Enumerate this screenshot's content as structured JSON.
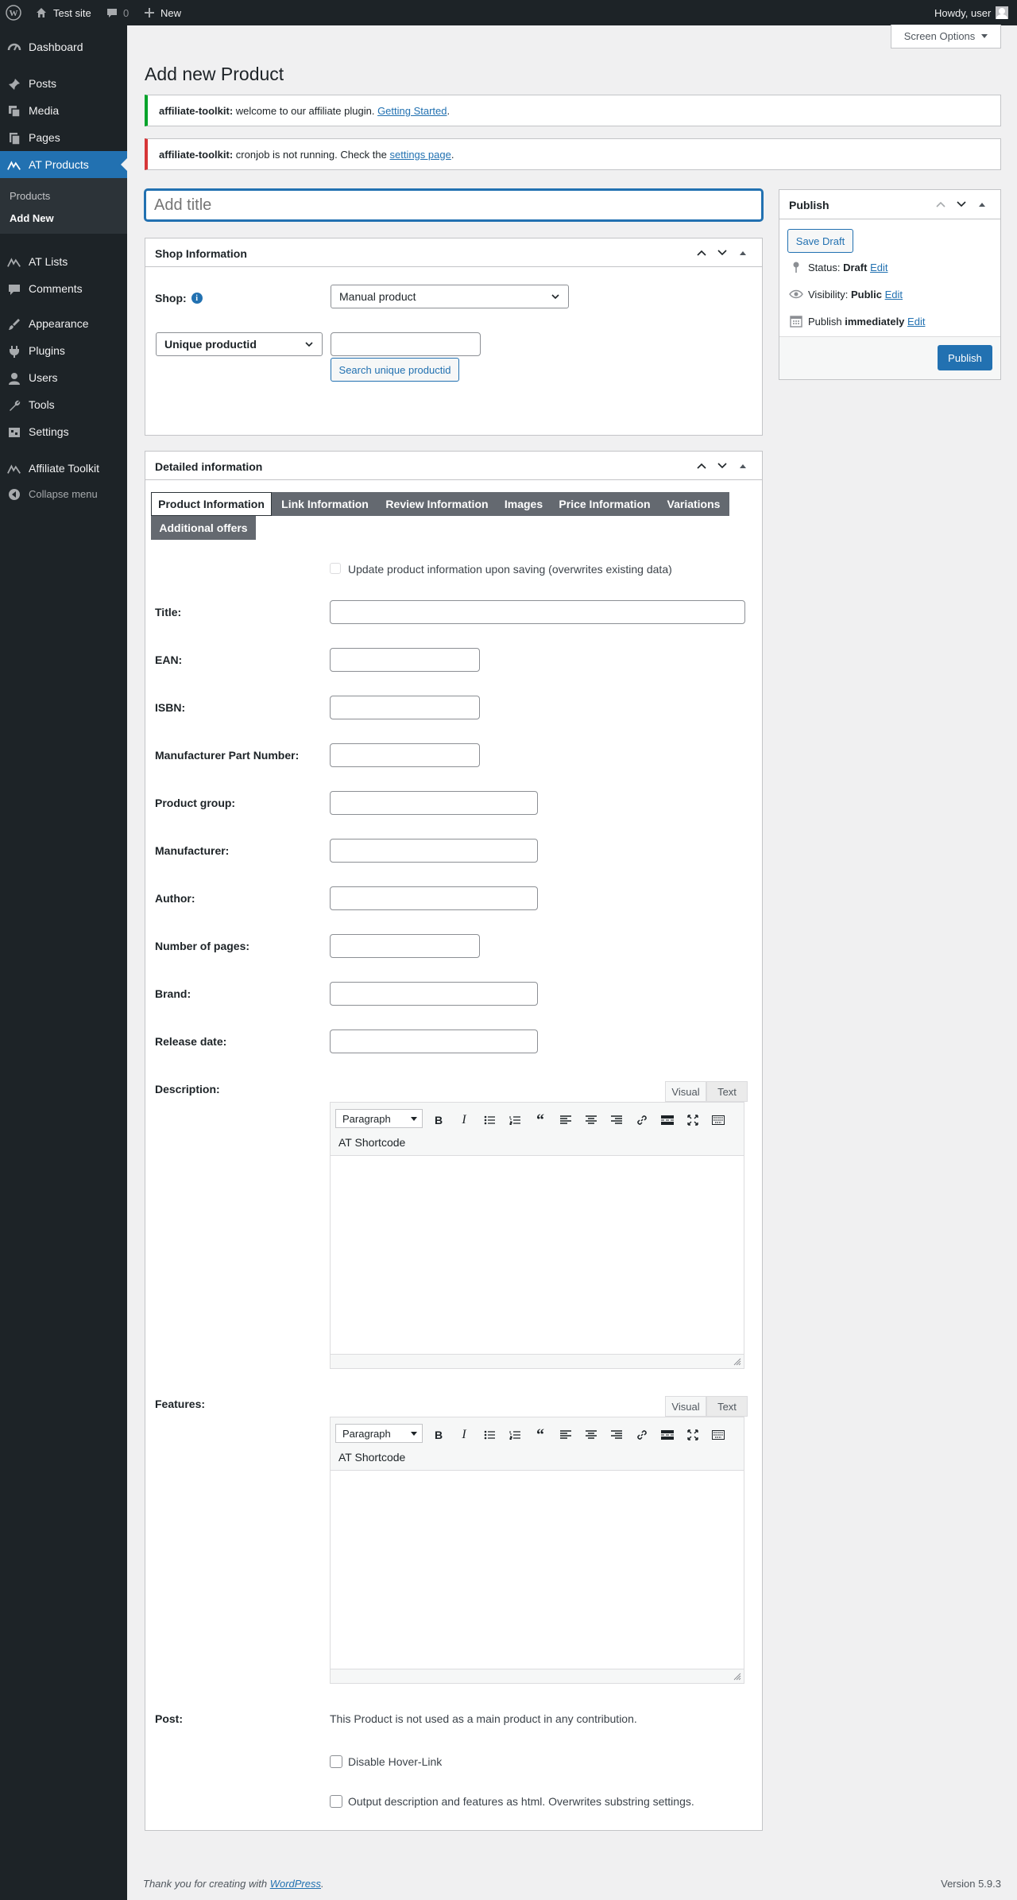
{
  "adminbar": {
    "site": "Test site",
    "comments": "0",
    "new": "New",
    "howdy": "Howdy, user"
  },
  "menu": {
    "dashboard": "Dashboard",
    "posts": "Posts",
    "media": "Media",
    "pages": "Pages",
    "at_products": "AT Products",
    "sub_products": "Products",
    "sub_add_new": "Add New",
    "at_lists": "AT Lists",
    "comments": "Comments",
    "appearance": "Appearance",
    "plugins": "Plugins",
    "users": "Users",
    "tools": "Tools",
    "settings": "Settings",
    "affiliate_toolkit": "Affiliate Toolkit",
    "collapse": "Collapse menu"
  },
  "screen_options": "Screen Options",
  "page_title": "Add new Product",
  "notices": {
    "n1_strong": "affiliate-toolkit:",
    "n1_text": "welcome to our affiliate plugin.",
    "n1_link": "Getting Started",
    "n1_end": ".",
    "n2_strong": "affiliate-toolkit:",
    "n2_text": "cronjob is not running. Check the",
    "n2_link": "settings page",
    "n2_end": "."
  },
  "title_placeholder": "Add title",
  "shop_box": {
    "title": "Shop Information",
    "shop_label": "Shop:",
    "shop_value": "Manual product",
    "id_type": "Unique productid",
    "search_button": "Search unique productid"
  },
  "detail_box": {
    "title": "Detailed information",
    "tabs": [
      "Product Information",
      "Link Information",
      "Review Information",
      "Images",
      "Price Information",
      "Variations",
      "Additional offers"
    ],
    "update_checkbox": "Update product information upon saving (overwrites existing data)",
    "fields": {
      "title": "Title:",
      "ean": "EAN:",
      "isbn": "ISBN:",
      "mpn": "Manufacturer Part Number:",
      "group": "Product group:",
      "manufacturer": "Manufacturer:",
      "author": "Author:",
      "pages": "Number of pages:",
      "brand": "Brand:",
      "release": "Release date:"
    },
    "description_label": "Description:",
    "features_label": "Features:",
    "post_label": "Post:",
    "post_text": "This Product is not used as a main product in any contribution.",
    "hover_link": "Disable Hover-Link",
    "output_html": "Output description and features as html. Overwrites substring settings."
  },
  "editor": {
    "visual": "Visual",
    "text": "Text",
    "format": "Paragraph",
    "shortcode": "AT Shortcode"
  },
  "publish": {
    "title": "Publish",
    "save_draft": "Save Draft",
    "status_label": "Status:",
    "status_value": "Draft",
    "visibility_label": "Visibility:",
    "visibility_value": "Public",
    "publish_label": "Publish",
    "publish_value": "immediately",
    "edit": "Edit",
    "button": "Publish"
  },
  "footer": {
    "thanks": "Thank you for creating with",
    "wp_link": "WordPress",
    "end": ".",
    "version": "Version 5.9.3"
  }
}
